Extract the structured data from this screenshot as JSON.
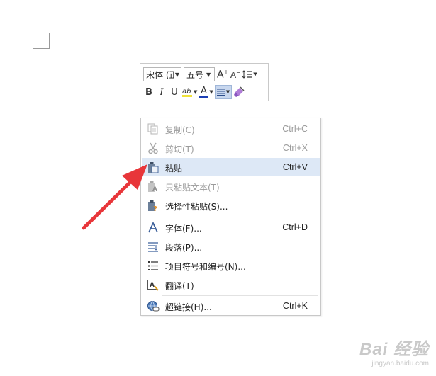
{
  "toolbar": {
    "font_name": "宋体 (正",
    "font_size": "五号",
    "grow_font": "A",
    "shrink_font": "A",
    "bold": "B",
    "italic": "I",
    "underline": "U",
    "font_color_glyph": "A",
    "highlight_color": "#f0e23a",
    "font_color": "#1c3fb4"
  },
  "menu": {
    "items": [
      {
        "label": "复制(C)",
        "shortcut": "Ctrl+C",
        "icon": "copy-icon",
        "enabled": false
      },
      {
        "label": "剪切(T)",
        "shortcut": "Ctrl+X",
        "icon": "cut-icon",
        "enabled": false
      },
      {
        "label": "粘贴",
        "shortcut": "Ctrl+V",
        "icon": "paste-icon",
        "enabled": true,
        "highlighted": true
      },
      {
        "label": "只粘贴文本(T)",
        "shortcut": "",
        "icon": "paste-text-icon",
        "enabled": false
      },
      {
        "label": "选择性粘贴(S)...",
        "shortcut": "",
        "icon": "paste-special-icon",
        "enabled": true
      },
      {
        "label": "字体(F)...",
        "shortcut": "Ctrl+D",
        "icon": "font-icon",
        "enabled": true
      },
      {
        "label": "段落(P)...",
        "shortcut": "",
        "icon": "paragraph-icon",
        "enabled": true
      },
      {
        "label": "项目符号和编号(N)...",
        "shortcut": "",
        "icon": "bullets-icon",
        "enabled": true
      },
      {
        "label": "翻译(T)",
        "shortcut": "",
        "icon": "translate-icon",
        "enabled": true
      },
      {
        "label": "超链接(H)...",
        "shortcut": "Ctrl+K",
        "icon": "hyperlink-icon",
        "enabled": true
      }
    ]
  },
  "watermark": {
    "line1": "Bai 经验",
    "line2": "jingyan.baidu.com"
  },
  "colors": {
    "accent_arrow": "#e8363a",
    "highlight_row": "#dde8f6"
  }
}
